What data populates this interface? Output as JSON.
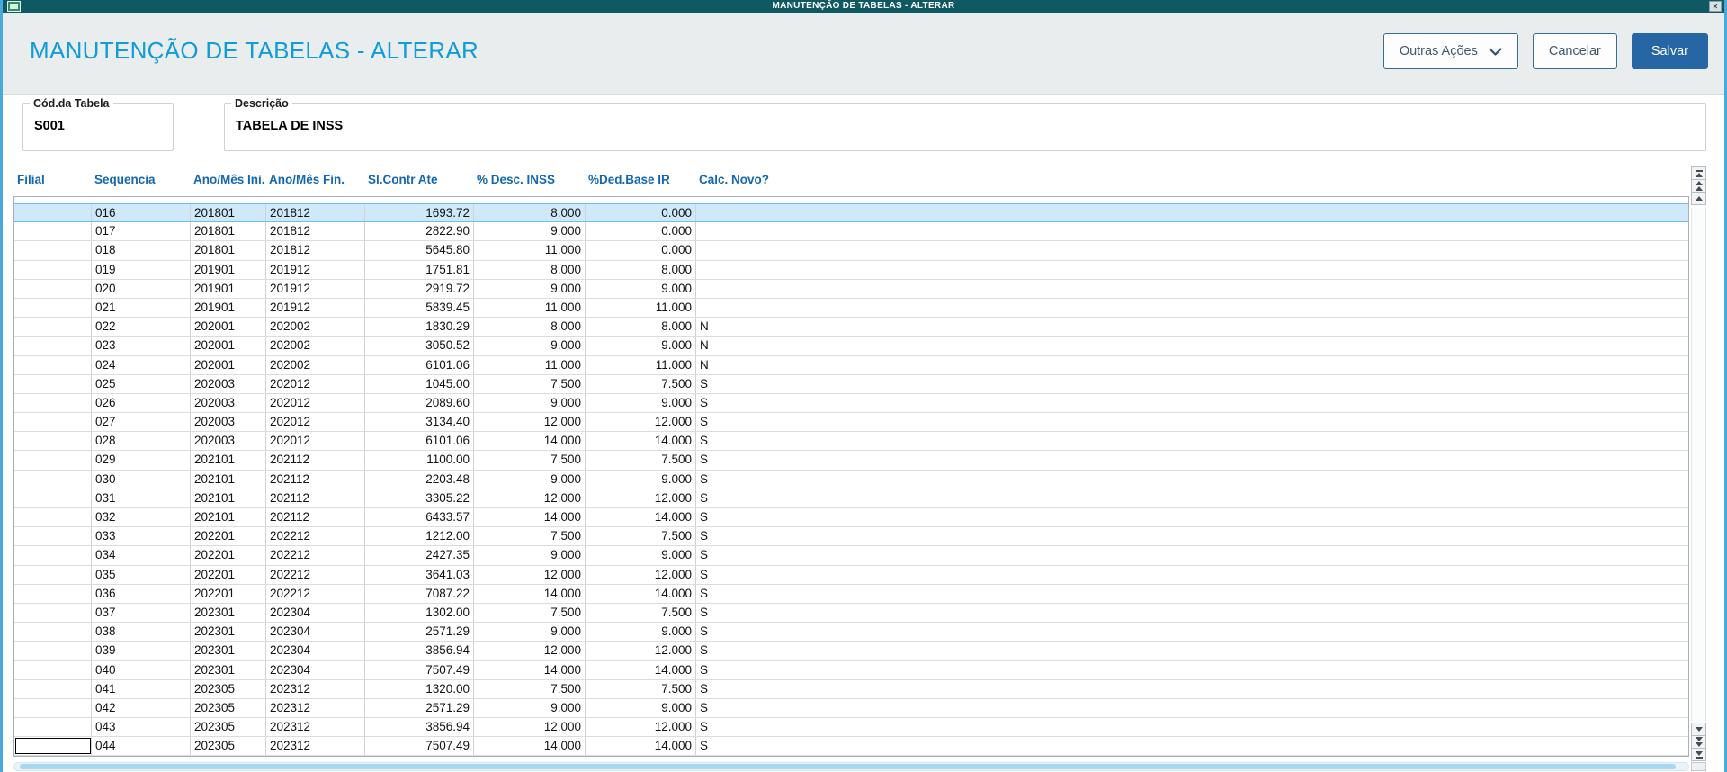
{
  "window": {
    "title": "MANUTENÇÃO DE TABELAS - ALTERAR",
    "close_glyph": "✕"
  },
  "header": {
    "title": "MANUTENÇÃO DE TABELAS - ALTERAR",
    "buttons": {
      "other_actions": "Outras Ações",
      "cancel": "Cancelar",
      "save": "Salvar"
    }
  },
  "form": {
    "table_code": {
      "label": "Cód.da Tabela",
      "value": "S001"
    },
    "description": {
      "label": "Descrição",
      "value": "TABELA DE INSS"
    }
  },
  "grid": {
    "columns": [
      {
        "label": "Filial",
        "key": "filial"
      },
      {
        "label": "Sequencia",
        "key": "sequencia"
      },
      {
        "label": "Ano/Mês Ini.",
        "key": "ano-mes-ini"
      },
      {
        "label": "Ano/Mês Fin.",
        "key": "ano-mes-fin"
      },
      {
        "label": "Sl.Contr Ate",
        "key": "sl-contr-ate"
      },
      {
        "label": "% Desc. INSS",
        "key": "perc-desc-inss"
      },
      {
        "label": "%Ded.Base IR",
        "key": "perc-ded-base-ir"
      },
      {
        "label": "Calc. Novo?",
        "key": "calc-novo"
      }
    ],
    "rows": [
      [
        "",
        "016",
        "201801",
        "201812",
        "1693.72",
        "8.000",
        "0.000",
        ""
      ],
      [
        "",
        "017",
        "201801",
        "201812",
        "2822.90",
        "9.000",
        "0.000",
        ""
      ],
      [
        "",
        "018",
        "201801",
        "201812",
        "5645.80",
        "11.000",
        "0.000",
        ""
      ],
      [
        "",
        "019",
        "201901",
        "201912",
        "1751.81",
        "8.000",
        "8.000",
        ""
      ],
      [
        "",
        "020",
        "201901",
        "201912",
        "2919.72",
        "9.000",
        "9.000",
        ""
      ],
      [
        "",
        "021",
        "201901",
        "201912",
        "5839.45",
        "11.000",
        "11.000",
        ""
      ],
      [
        "",
        "022",
        "202001",
        "202002",
        "1830.29",
        "8.000",
        "8.000",
        "N"
      ],
      [
        "",
        "023",
        "202001",
        "202002",
        "3050.52",
        "9.000",
        "9.000",
        "N"
      ],
      [
        "",
        "024",
        "202001",
        "202002",
        "6101.06",
        "11.000",
        "11.000",
        "N"
      ],
      [
        "",
        "025",
        "202003",
        "202012",
        "1045.00",
        "7.500",
        "7.500",
        "S"
      ],
      [
        "",
        "026",
        "202003",
        "202012",
        "2089.60",
        "9.000",
        "9.000",
        "S"
      ],
      [
        "",
        "027",
        "202003",
        "202012",
        "3134.40",
        "12.000",
        "12.000",
        "S"
      ],
      [
        "",
        "028",
        "202003",
        "202012",
        "6101.06",
        "14.000",
        "14.000",
        "S"
      ],
      [
        "",
        "029",
        "202101",
        "202112",
        "1100.00",
        "7.500",
        "7.500",
        "S"
      ],
      [
        "",
        "030",
        "202101",
        "202112",
        "2203.48",
        "9.000",
        "9.000",
        "S"
      ],
      [
        "",
        "031",
        "202101",
        "202112",
        "3305.22",
        "12.000",
        "12.000",
        "S"
      ],
      [
        "",
        "032",
        "202101",
        "202112",
        "6433.57",
        "14.000",
        "14.000",
        "S"
      ],
      [
        "",
        "033",
        "202201",
        "202212",
        "1212.00",
        "7.500",
        "7.500",
        "S"
      ],
      [
        "",
        "034",
        "202201",
        "202212",
        "2427.35",
        "9.000",
        "9.000",
        "S"
      ],
      [
        "",
        "035",
        "202201",
        "202212",
        "3641.03",
        "12.000",
        "12.000",
        "S"
      ],
      [
        "",
        "036",
        "202201",
        "202212",
        "7087.22",
        "14.000",
        "14.000",
        "S"
      ],
      [
        "",
        "037",
        "202301",
        "202304",
        "1302.00",
        "7.500",
        "7.500",
        "S"
      ],
      [
        "",
        "038",
        "202301",
        "202304",
        "2571.29",
        "9.000",
        "9.000",
        "S"
      ],
      [
        "",
        "039",
        "202301",
        "202304",
        "3856.94",
        "12.000",
        "12.000",
        "S"
      ],
      [
        "",
        "040",
        "202301",
        "202304",
        "7507.49",
        "14.000",
        "14.000",
        "S"
      ],
      [
        "",
        "041",
        "202305",
        "202312",
        "1320.00",
        "7.500",
        "7.500",
        "S"
      ],
      [
        "",
        "042",
        "202305",
        "202312",
        "2571.29",
        "9.000",
        "9.000",
        "S"
      ],
      [
        "",
        "043",
        "202305",
        "202312",
        "3856.94",
        "12.000",
        "12.000",
        "S"
      ],
      [
        "",
        "044",
        "202305",
        "202312",
        "7507.49",
        "14.000",
        "14.000",
        "S"
      ]
    ],
    "selected_row_index": 0,
    "focused_cell": {
      "row": 28,
      "col": 0
    }
  },
  "icons": {
    "close": "✕",
    "chevron_down": "svg-chevron-down",
    "scroll_up": "css-triangle-up",
    "scroll_down": "css-triangle-down"
  },
  "colors": {
    "titlebar_bg": "#0e5962",
    "window_border": "#49a8dc",
    "toolbar_bg": "#eaedee",
    "accent": "#0f9cd8",
    "primary_btn": "#2766a4",
    "header_text": "#1368b0",
    "selected_row_bg": "#cfe9fb",
    "selected_row_border": "#6fbfed",
    "hscroll_thumb": "#a9d6f0"
  }
}
